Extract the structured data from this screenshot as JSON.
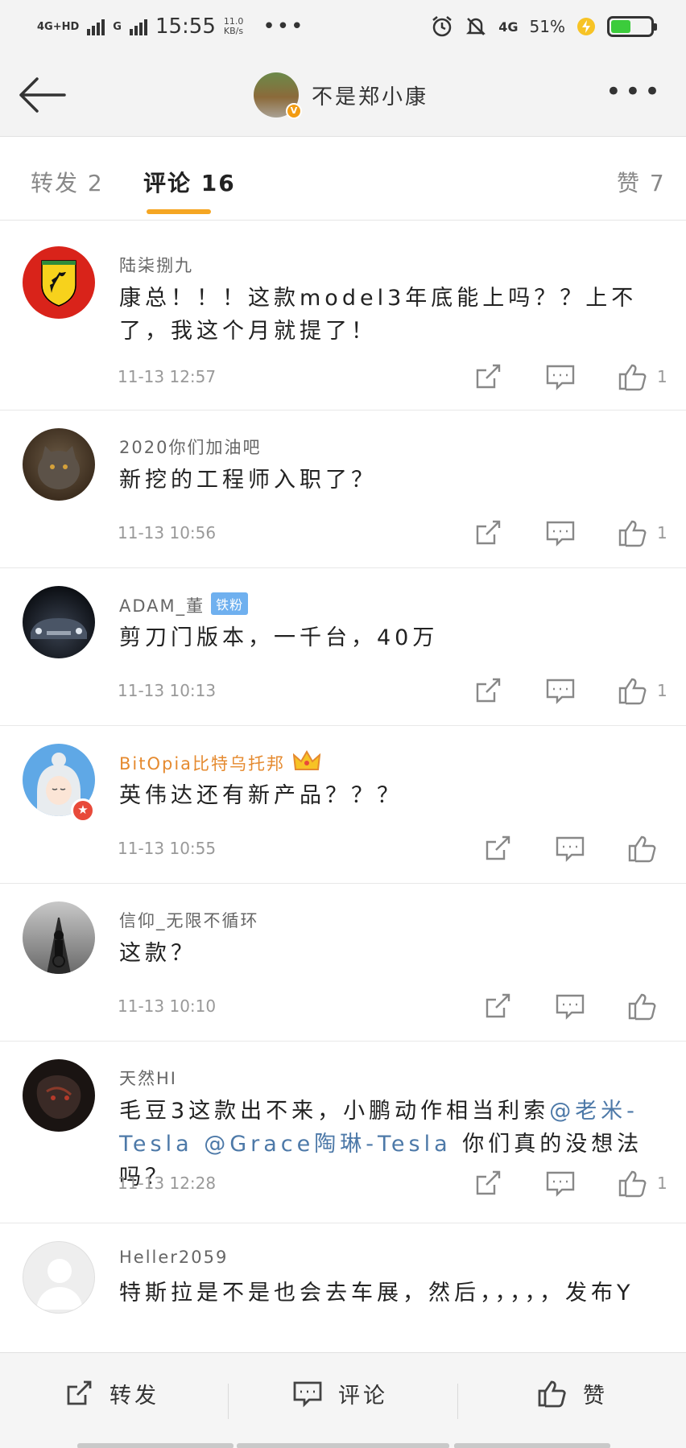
{
  "status_bar": {
    "network": "4G+HD",
    "network2": "G",
    "time": "15:55",
    "speed_value": "11.0",
    "speed_unit": "KB/s",
    "dots": "•••",
    "network_right": "4G",
    "battery_percent": "51%",
    "battery_level": 0.51
  },
  "nav": {
    "title": "不是郑小康",
    "back_icon": "back-arrow-icon",
    "more_icon": "more-dots-icon",
    "more_label": "•••"
  },
  "tabs": [
    {
      "label": "转发 2"
    },
    {
      "label": "评论 16"
    },
    {
      "label": "赞 7"
    }
  ],
  "comments": [
    {
      "name": "陆柒捌九",
      "text": "康总！！！这款model3年底能上吗？？上不了，我这个月就提了！",
      "time": "11-13 12:57",
      "likes": "1"
    },
    {
      "name": "2020你们加油吧",
      "text": "新挖的工程师入职了？",
      "time": "11-13 10:56",
      "likes": "1"
    },
    {
      "name": "ADAM_董",
      "badge": "铁粉",
      "text": "剪刀门版本，一千台，40万",
      "time": "11-13 10:13",
      "likes": "1"
    },
    {
      "name": "BitOpia比特乌托邦",
      "text": "英伟达还有新产品？？？",
      "time": "11-13 10:55",
      "likes": ""
    },
    {
      "name": "信仰_无限不循环",
      "text": "这款？",
      "time": "11-13 10:10",
      "likes": ""
    },
    {
      "name": "天然HI",
      "text_before": "毛豆3这款出不来，小鹏动作相当利索",
      "mention1": "@老米-Tesla",
      "mention2": "@Grace陶琳-Tesla",
      "text_after": "你们真的没想法吗？",
      "time": "11-13 12:28",
      "likes": "1"
    },
    {
      "name": "Heller2059",
      "text": "特斯拉是不是也会去车展，然后，，，，，发布Y"
    }
  ],
  "bottom_bar": {
    "repost": "转发",
    "comment": "评论",
    "like": "赞"
  },
  "colors": {
    "accent": "#f5a623",
    "mention": "#4d79a8",
    "vip_name": "#e58a2f",
    "fan_badge": "#6fb0ef"
  }
}
